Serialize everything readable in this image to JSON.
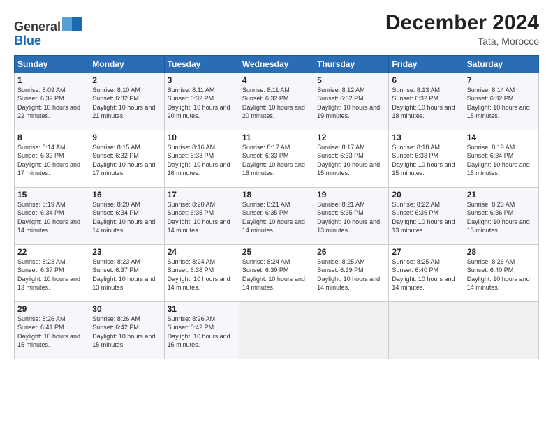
{
  "header": {
    "logo_line1": "General",
    "logo_line2": "Blue",
    "month_title": "December 2024",
    "location": "Tata, Morocco"
  },
  "days_of_week": [
    "Sunday",
    "Monday",
    "Tuesday",
    "Wednesday",
    "Thursday",
    "Friday",
    "Saturday"
  ],
  "weeks": [
    [
      {
        "day": "1",
        "sunrise": "Sunrise: 8:09 AM",
        "sunset": "Sunset: 6:32 PM",
        "daylight": "Daylight: 10 hours and 22 minutes."
      },
      {
        "day": "2",
        "sunrise": "Sunrise: 8:10 AM",
        "sunset": "Sunset: 6:32 PM",
        "daylight": "Daylight: 10 hours and 21 minutes."
      },
      {
        "day": "3",
        "sunrise": "Sunrise: 8:11 AM",
        "sunset": "Sunset: 6:32 PM",
        "daylight": "Daylight: 10 hours and 20 minutes."
      },
      {
        "day": "4",
        "sunrise": "Sunrise: 8:11 AM",
        "sunset": "Sunset: 6:32 PM",
        "daylight": "Daylight: 10 hours and 20 minutes."
      },
      {
        "day": "5",
        "sunrise": "Sunrise: 8:12 AM",
        "sunset": "Sunset: 6:32 PM",
        "daylight": "Daylight: 10 hours and 19 minutes."
      },
      {
        "day": "6",
        "sunrise": "Sunrise: 8:13 AM",
        "sunset": "Sunset: 6:32 PM",
        "daylight": "Daylight: 10 hours and 18 minutes."
      },
      {
        "day": "7",
        "sunrise": "Sunrise: 8:14 AM",
        "sunset": "Sunset: 6:32 PM",
        "daylight": "Daylight: 10 hours and 18 minutes."
      }
    ],
    [
      {
        "day": "8",
        "sunrise": "Sunrise: 8:14 AM",
        "sunset": "Sunset: 6:32 PM",
        "daylight": "Daylight: 10 hours and 17 minutes."
      },
      {
        "day": "9",
        "sunrise": "Sunrise: 8:15 AM",
        "sunset": "Sunset: 6:32 PM",
        "daylight": "Daylight: 10 hours and 17 minutes."
      },
      {
        "day": "10",
        "sunrise": "Sunrise: 8:16 AM",
        "sunset": "Sunset: 6:33 PM",
        "daylight": "Daylight: 10 hours and 16 minutes."
      },
      {
        "day": "11",
        "sunrise": "Sunrise: 8:17 AM",
        "sunset": "Sunset: 6:33 PM",
        "daylight": "Daylight: 10 hours and 16 minutes."
      },
      {
        "day": "12",
        "sunrise": "Sunrise: 8:17 AM",
        "sunset": "Sunset: 6:33 PM",
        "daylight": "Daylight: 10 hours and 15 minutes."
      },
      {
        "day": "13",
        "sunrise": "Sunrise: 8:18 AM",
        "sunset": "Sunset: 6:33 PM",
        "daylight": "Daylight: 10 hours and 15 minutes."
      },
      {
        "day": "14",
        "sunrise": "Sunrise: 8:19 AM",
        "sunset": "Sunset: 6:34 PM",
        "daylight": "Daylight: 10 hours and 15 minutes."
      }
    ],
    [
      {
        "day": "15",
        "sunrise": "Sunrise: 8:19 AM",
        "sunset": "Sunset: 6:34 PM",
        "daylight": "Daylight: 10 hours and 14 minutes."
      },
      {
        "day": "16",
        "sunrise": "Sunrise: 8:20 AM",
        "sunset": "Sunset: 6:34 PM",
        "daylight": "Daylight: 10 hours and 14 minutes."
      },
      {
        "day": "17",
        "sunrise": "Sunrise: 8:20 AM",
        "sunset": "Sunset: 6:35 PM",
        "daylight": "Daylight: 10 hours and 14 minutes."
      },
      {
        "day": "18",
        "sunrise": "Sunrise: 8:21 AM",
        "sunset": "Sunset: 6:35 PM",
        "daylight": "Daylight: 10 hours and 14 minutes."
      },
      {
        "day": "19",
        "sunrise": "Sunrise: 8:21 AM",
        "sunset": "Sunset: 6:35 PM",
        "daylight": "Daylight: 10 hours and 13 minutes."
      },
      {
        "day": "20",
        "sunrise": "Sunrise: 8:22 AM",
        "sunset": "Sunset: 6:36 PM",
        "daylight": "Daylight: 10 hours and 13 minutes."
      },
      {
        "day": "21",
        "sunrise": "Sunrise: 8:23 AM",
        "sunset": "Sunset: 6:36 PM",
        "daylight": "Daylight: 10 hours and 13 minutes."
      }
    ],
    [
      {
        "day": "22",
        "sunrise": "Sunrise: 8:23 AM",
        "sunset": "Sunset: 6:37 PM",
        "daylight": "Daylight: 10 hours and 13 minutes."
      },
      {
        "day": "23",
        "sunrise": "Sunrise: 8:23 AM",
        "sunset": "Sunset: 6:37 PM",
        "daylight": "Daylight: 10 hours and 13 minutes."
      },
      {
        "day": "24",
        "sunrise": "Sunrise: 8:24 AM",
        "sunset": "Sunset: 6:38 PM",
        "daylight": "Daylight: 10 hours and 14 minutes."
      },
      {
        "day": "25",
        "sunrise": "Sunrise: 8:24 AM",
        "sunset": "Sunset: 6:39 PM",
        "daylight": "Daylight: 10 hours and 14 minutes."
      },
      {
        "day": "26",
        "sunrise": "Sunrise: 8:25 AM",
        "sunset": "Sunset: 6:39 PM",
        "daylight": "Daylight: 10 hours and 14 minutes."
      },
      {
        "day": "27",
        "sunrise": "Sunrise: 8:25 AM",
        "sunset": "Sunset: 6:40 PM",
        "daylight": "Daylight: 10 hours and 14 minutes."
      },
      {
        "day": "28",
        "sunrise": "Sunrise: 8:26 AM",
        "sunset": "Sunset: 6:40 PM",
        "daylight": "Daylight: 10 hours and 14 minutes."
      }
    ],
    [
      {
        "day": "29",
        "sunrise": "Sunrise: 8:26 AM",
        "sunset": "Sunset: 6:41 PM",
        "daylight": "Daylight: 10 hours and 15 minutes."
      },
      {
        "day": "30",
        "sunrise": "Sunrise: 8:26 AM",
        "sunset": "Sunset: 6:42 PM",
        "daylight": "Daylight: 10 hours and 15 minutes."
      },
      {
        "day": "31",
        "sunrise": "Sunrise: 8:26 AM",
        "sunset": "Sunset: 6:42 PM",
        "daylight": "Daylight: 10 hours and 15 minutes."
      },
      null,
      null,
      null,
      null
    ]
  ]
}
